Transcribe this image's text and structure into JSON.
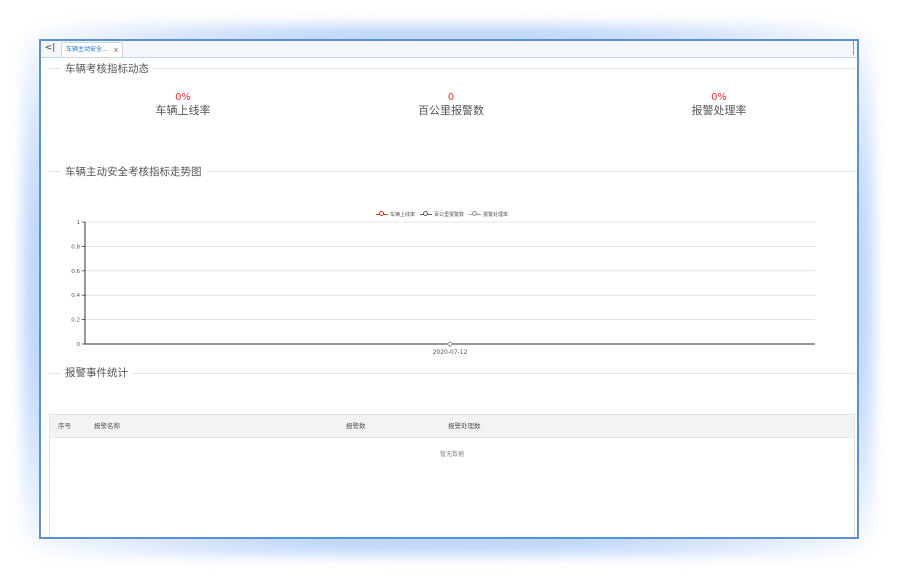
{
  "tab": {
    "label": "车辆主动安全...",
    "close": "x",
    "scroll_left": "<|"
  },
  "sections": {
    "metrics_title": "车辆考核指标动态",
    "trend_title": "车辆主动安全考核指标走势图",
    "alarm_title": "报警事件统计"
  },
  "metrics": [
    {
      "value": "0%",
      "label": "车辆上线率"
    },
    {
      "value": "0",
      "label": "百公里报警数"
    },
    {
      "value": "0%",
      "label": "报警处理率"
    }
  ],
  "chart_data": {
    "type": "line",
    "x": [
      "2020-07-12"
    ],
    "series": [
      {
        "name": "车辆上线率",
        "values": [
          0
        ],
        "color": "#e8302f"
      },
      {
        "name": "百公里报警数",
        "values": [
          0
        ],
        "color": "#666666"
      },
      {
        "name": "报警处理率",
        "values": [
          0
        ],
        "color": "#8c9aa8"
      }
    ],
    "ylim": [
      0,
      1
    ],
    "yticks": [
      "0",
      "0.2",
      "0.4",
      "0.6",
      "0.8",
      "1"
    ],
    "grid": true,
    "legend": "top-center"
  },
  "table": {
    "columns": [
      "序号",
      "报警名称",
      "报警数",
      "报警处理数"
    ],
    "rows": [],
    "empty_text": "暂无数据"
  }
}
